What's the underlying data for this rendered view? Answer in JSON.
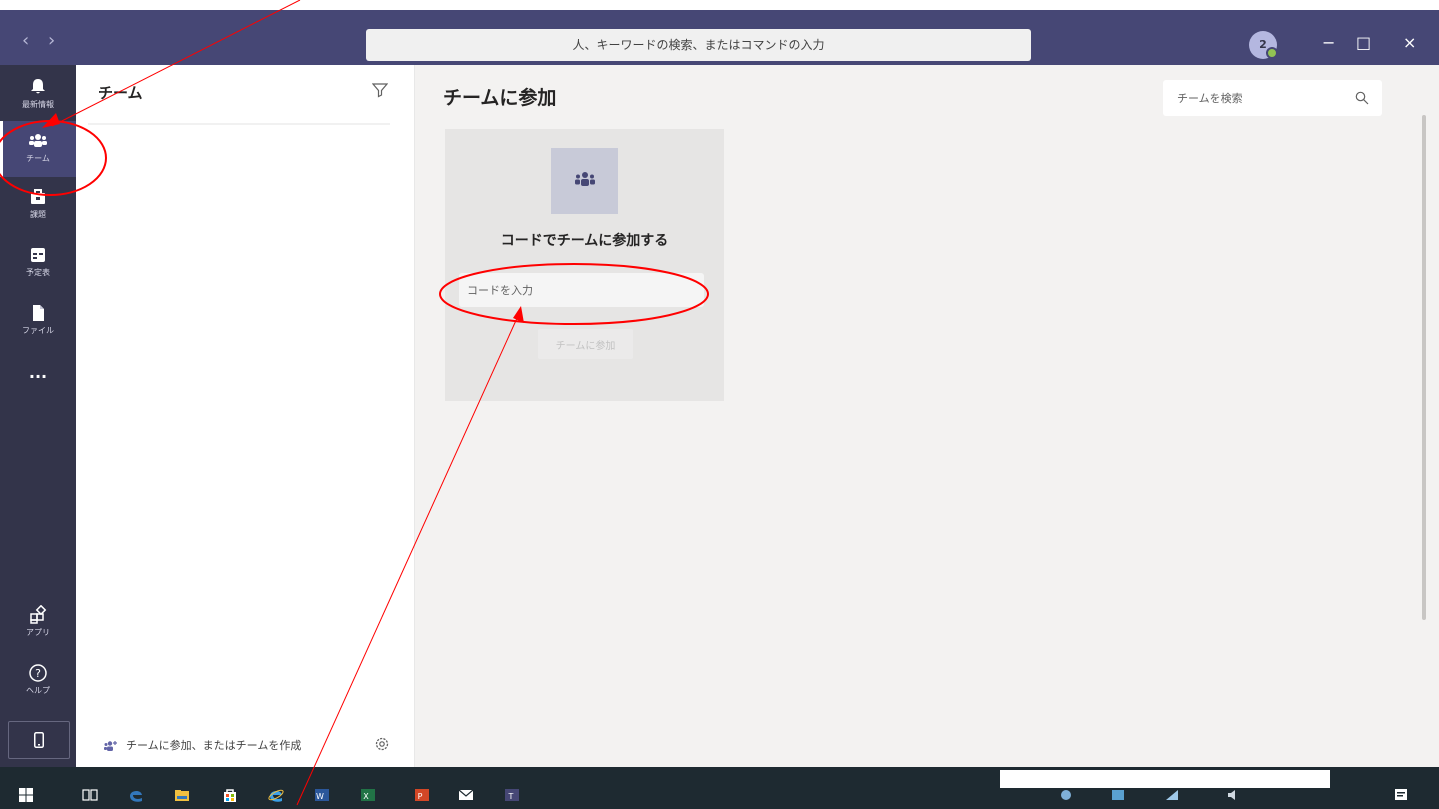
{
  "colors": {
    "titlebar": "#464775",
    "rail": "#33344a",
    "accent": "#6264a7",
    "annotation": "#ff0000",
    "main_bg": "#f3f2f1",
    "taskbar": "#1e2a31"
  },
  "titlebar": {
    "back_icon": "chevron-left-icon",
    "forward_icon": "chevron-right-icon",
    "search_text": "人、キーワードの検索、またはコマンドの入力",
    "avatar_initial": "2",
    "minimize": "−",
    "maximize": "□",
    "close": "×"
  },
  "rail": {
    "items": [
      {
        "label": "最新情報",
        "icon": "bell-icon"
      },
      {
        "label": "チーム",
        "icon": "teams-icon",
        "active": true
      },
      {
        "label": "課題",
        "icon": "assignments-icon"
      },
      {
        "label": "予定表",
        "icon": "calendar-icon"
      },
      {
        "label": "ファイル",
        "icon": "file-icon"
      },
      {
        "label": "...",
        "icon": "more-icon"
      },
      {
        "label": "アプリ",
        "icon": "apps-icon"
      },
      {
        "label": "ヘルプ",
        "icon": "help-icon"
      }
    ]
  },
  "teams_pane": {
    "header": "チーム",
    "footer_label": "チームに参加、またはチームを作成"
  },
  "main": {
    "title": "チームに参加",
    "search_placeholder": "チームを検索",
    "card": {
      "title": "コードでチームに参加する",
      "code_placeholder": "コードを入力",
      "join_button": "チームに参加"
    }
  }
}
